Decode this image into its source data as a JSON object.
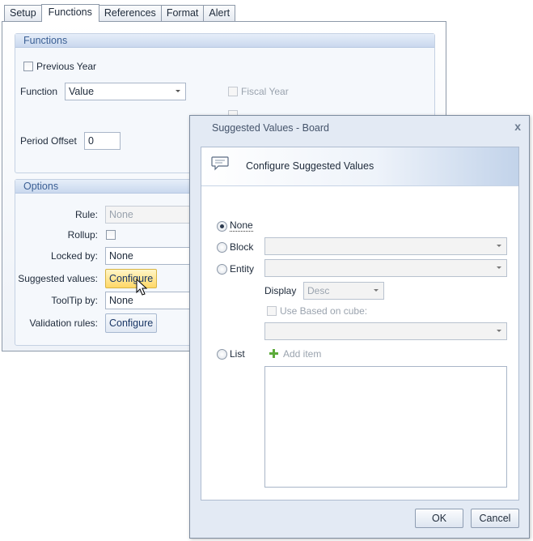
{
  "tabs": [
    "Setup",
    "Functions",
    "References",
    "Format",
    "Alert"
  ],
  "active_tab": "Functions",
  "functions_group": {
    "title": "Functions",
    "previous_year_label": "Previous Year",
    "function_label": "Function",
    "function_value": "Value",
    "fiscal_year_label": "Fiscal Year",
    "period_offset_label": "Period Offset",
    "period_offset_value": "0"
  },
  "options_group": {
    "title": "Options",
    "rule_label": "Rule:",
    "rule_value": "None",
    "rollup_label": "Rollup:",
    "locked_by_label": "Locked by:",
    "locked_by_value": "None",
    "suggested_values_label": "Suggested values:",
    "suggested_values_button": "Configure",
    "tooltip_by_label": "ToolTip by:",
    "tooltip_by_value": "None",
    "validation_rules_label": "Validation rules:",
    "validation_rules_button": "Configure"
  },
  "dialog": {
    "title": "Suggested Values - Board",
    "close_glyph": "x",
    "banner_title": "Configure Suggested Values",
    "radio_none": "None",
    "radio_block": "Block",
    "radio_entity": "Entity",
    "display_label": "Display",
    "display_value": "Desc",
    "use_based_on_cube_label": "Use Based on cube:",
    "radio_list": "List",
    "add_item_label": "Add item",
    "ok_button": "OK",
    "cancel_button": "Cancel",
    "selected": "None"
  },
  "icons": {
    "banner": "speech-bubble-icon",
    "add": "plus-icon",
    "cursor": "mouse-pointer-icon"
  },
  "colors": {
    "accent": "#3b5f94",
    "hover_button": "#ffd867"
  }
}
